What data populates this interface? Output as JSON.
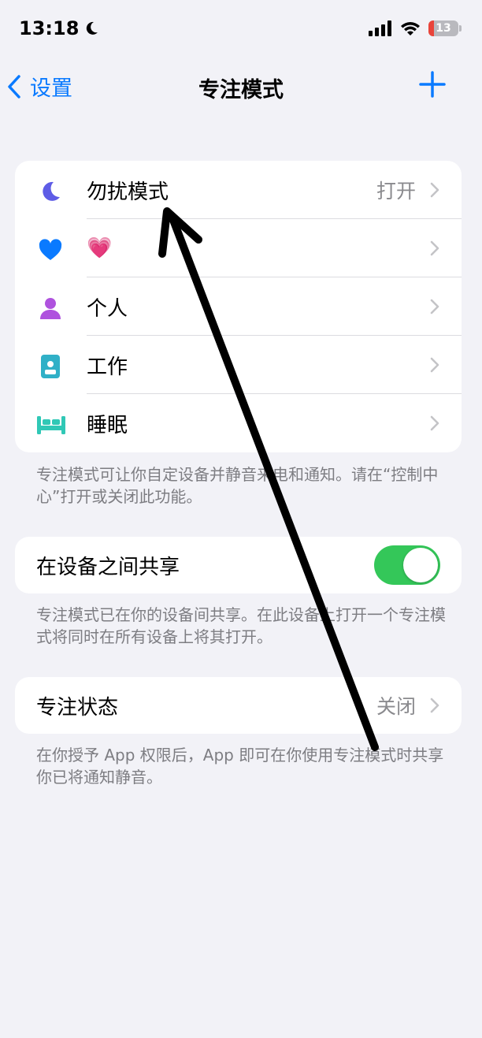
{
  "status_bar": {
    "time": "13:18",
    "battery_level": "13"
  },
  "nav": {
    "back_label": "设置",
    "title": "专注模式"
  },
  "focus_modes": [
    {
      "label": "勿扰模式",
      "value": "打开",
      "icon": "moon-icon"
    },
    {
      "label": "💗",
      "value": "",
      "icon": "heart-icon"
    },
    {
      "label": "个人",
      "value": "",
      "icon": "person-icon"
    },
    {
      "label": "工作",
      "value": "",
      "icon": "id-badge-icon"
    },
    {
      "label": "睡眠",
      "value": "",
      "icon": "bed-icon"
    }
  ],
  "focus_note": "专注模式可让你自定设备并静音来电和通知。请在“控制中心”打开或关闭此功能。",
  "share": {
    "label": "在设备之间共享",
    "enabled": true
  },
  "share_note": "专注模式已在你的设备间共享。在此设备上打开一个专注模式将同时在所有设备上将其打开。",
  "focus_status": {
    "label": "专注状态",
    "value": "关闭"
  },
  "status_note": "在你授予 App 权限后，App 即可在你使用专注模式时共享你已将通知静音。",
  "colors": {
    "accent": "#0a7aff",
    "toggle_on": "#34c759",
    "moon": "#5e5ce6",
    "heart": "#0a7aff",
    "person": "#af52de",
    "badge": "#30b0c7",
    "bed": "#30c8b6"
  }
}
